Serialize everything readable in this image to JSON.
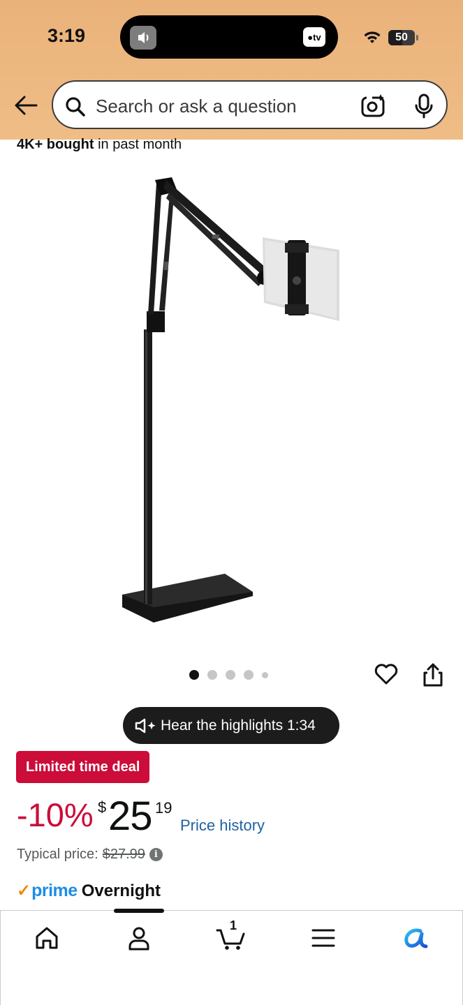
{
  "status_bar": {
    "time": "3:19",
    "tv_label": "tv",
    "battery": "50"
  },
  "search": {
    "placeholder": "Search or ask a question"
  },
  "product": {
    "bought_bold": "4K+ bought",
    "bought_rest": " in past month",
    "image_count": 5,
    "active_image": 1
  },
  "highlights": {
    "label": "Hear the highlights 1:34"
  },
  "deal": {
    "badge": "Limited time deal"
  },
  "price": {
    "discount": "-10%",
    "symbol": "$",
    "whole": "25",
    "fraction": "19",
    "history_link": "Price history",
    "typical_label": "Typical price:",
    "typical_value": "$27.99"
  },
  "delivery": {
    "prime_word": "prime",
    "speed": "Overnight"
  },
  "nav": {
    "cart_count": "1"
  },
  "colors": {
    "header_bg": "#eab27a",
    "deal_red": "#cc0c39",
    "link_blue": "#2162a1",
    "prime_blue": "#1f8ce6"
  }
}
